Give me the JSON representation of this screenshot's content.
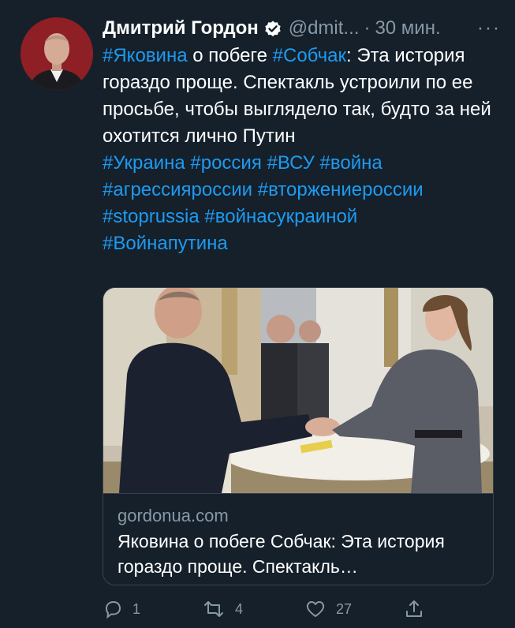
{
  "author": {
    "name": "Дмитрий Гордон",
    "handle": "@dmit...",
    "separator": "·",
    "time": "30 мин.",
    "more": "···"
  },
  "tweet": {
    "t1": "#Яковина",
    "t2": " о побеге ",
    "t3": "#Собчак",
    "t4": ": Эта история гораздо проще. Спектакль устроили по ее просьбе, чтобы выглядело так, будто за ней охотится лично Путин",
    "tags": [
      "#Украина",
      "#россия",
      "#ВСУ",
      "#война",
      "#агрессияроссии",
      "#вторжениероссии",
      "#stoprussia",
      "#войнасукраиной",
      "#Войнапутина"
    ]
  },
  "card": {
    "domain": "gordonua.com",
    "title": "Яковина о побеге Собчак: Эта история гораздо проще. Спектакль…"
  },
  "actions": {
    "reply_count": "1",
    "retweet_count": "4",
    "like_count": "27"
  },
  "colors": {
    "background": "#15202b",
    "link": "#1d9bf0",
    "muted": "#8899a6",
    "border": "#38444d"
  }
}
